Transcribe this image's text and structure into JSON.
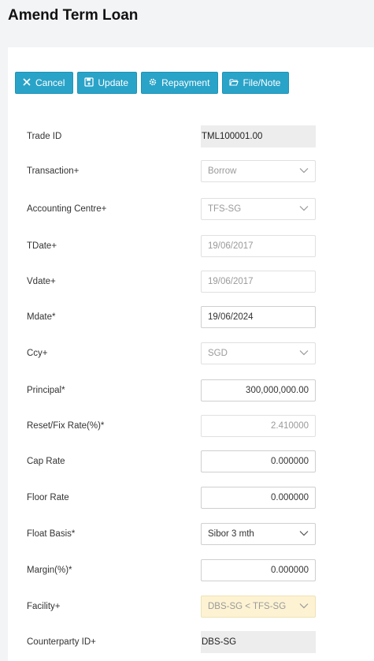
{
  "page": {
    "title": "Amend Term Loan"
  },
  "toolbar": {
    "cancel": "Cancel",
    "update": "Update",
    "repayment": "Repayment",
    "file_note": "File/Note"
  },
  "fields": {
    "trade_id": {
      "label": "Trade ID",
      "value": "TML100001.00"
    },
    "transaction": {
      "label": "Transaction+",
      "value": "Borrow"
    },
    "accounting_centre": {
      "label": "Accounting Centre+",
      "value": "TFS-SG"
    },
    "tdate": {
      "label": "TDate+",
      "value": "19/06/2017"
    },
    "vdate": {
      "label": "Vdate+",
      "value": "19/06/2017"
    },
    "mdate": {
      "label": "Mdate*",
      "value": "19/06/2024"
    },
    "ccy": {
      "label": "Ccy+",
      "value": "SGD"
    },
    "principal": {
      "label": "Principal*",
      "value": "300,000,000.00"
    },
    "reset_fix_rate": {
      "label": "Reset/Fix Rate(%)*",
      "value": "2.410000"
    },
    "cap_rate": {
      "label": "Cap Rate",
      "value": "0.000000"
    },
    "floor_rate": {
      "label": "Floor Rate",
      "value": "0.000000"
    },
    "float_basis": {
      "label": "Float Basis*",
      "value": "Sibor 3 mth"
    },
    "margin": {
      "label": "Margin(%)*",
      "value": "0.000000"
    },
    "facility": {
      "label": "Facility+",
      "value": "DBS-SG < TFS-SG"
    },
    "counterparty_id": {
      "label": "Counterparty ID+",
      "value": "DBS-SG"
    }
  },
  "icons": {
    "cancel": "close-icon",
    "update": "save-icon",
    "repayment": "gear-icon",
    "file_note": "folder-open-icon",
    "dropdown": "chevron-down-icon"
  },
  "colors": {
    "button": "#2aa3c8",
    "facility_highlight": "#fdf3d3"
  }
}
